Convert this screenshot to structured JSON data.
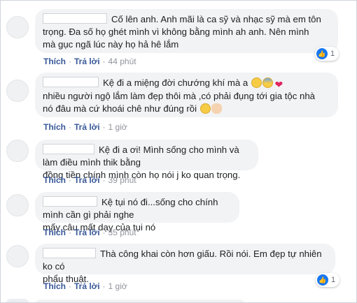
{
  "comments": [
    {
      "lines": [
        "Cố lên anh. Anh mãi là ca sỹ và nhạc sỹ mà em tôn",
        "trọng. Đa số họ ghét mình vì không bằng mình ah anh. Nên mình",
        "mà gục ngã lúc này họ hả hê lắm"
      ],
      "like_label": "Thích",
      "reply_label": "Trả lời",
      "time": "44 phút",
      "reaction_count": "1"
    },
    {
      "lines": [
        "Kệ đi a miệng đời chướng khí mà a",
        "nhiều người ngộ lắm làm đẹp thôi mà ,có phải đụng tới gia tộc nhà",
        "nó đâu mà cứ khoái chê như đúng rồi"
      ],
      "like_label": "Thích",
      "reply_label": "Trả lời",
      "time": "1 giờ",
      "emojis_line1": [
        "sad-face-emoji",
        "fearful-face-emoji",
        "heart-emoji"
      ],
      "emojis_line3": [
        "grimace-face-emoji",
        "ok-hand-emoji"
      ]
    },
    {
      "lines": [
        "Kệ đi a ơi! Mình sống cho mình và làm điều mình thik bằng",
        "đồng tiền chính mình còn họ nói j ko quan trọng."
      ],
      "like_label": "Thích",
      "reply_label": "Trả lời",
      "time": "39 phút"
    },
    {
      "lines": [
        "Kệ tụi nó đi...sống cho chính mình cần gì phải nghe",
        "mấy câu mất dạy của tụi nó"
      ],
      "like_label": "Thích",
      "reply_label": "Trả lời",
      "time": "35 phút"
    },
    {
      "lines": [
        "Thà công khai còn hơn giấu. Rồi nói. Em đẹp tự nhiên ko có",
        "phẩu thuật."
      ],
      "like_label": "Thích",
      "reply_label": "Trả lời",
      "time": "1 giờ",
      "reaction_count": "1"
    }
  ],
  "colors": {
    "bubble": "#f2f3f5",
    "action_link": "#385898",
    "meta_text": "#90949c",
    "like_blue": "#1877f2"
  }
}
